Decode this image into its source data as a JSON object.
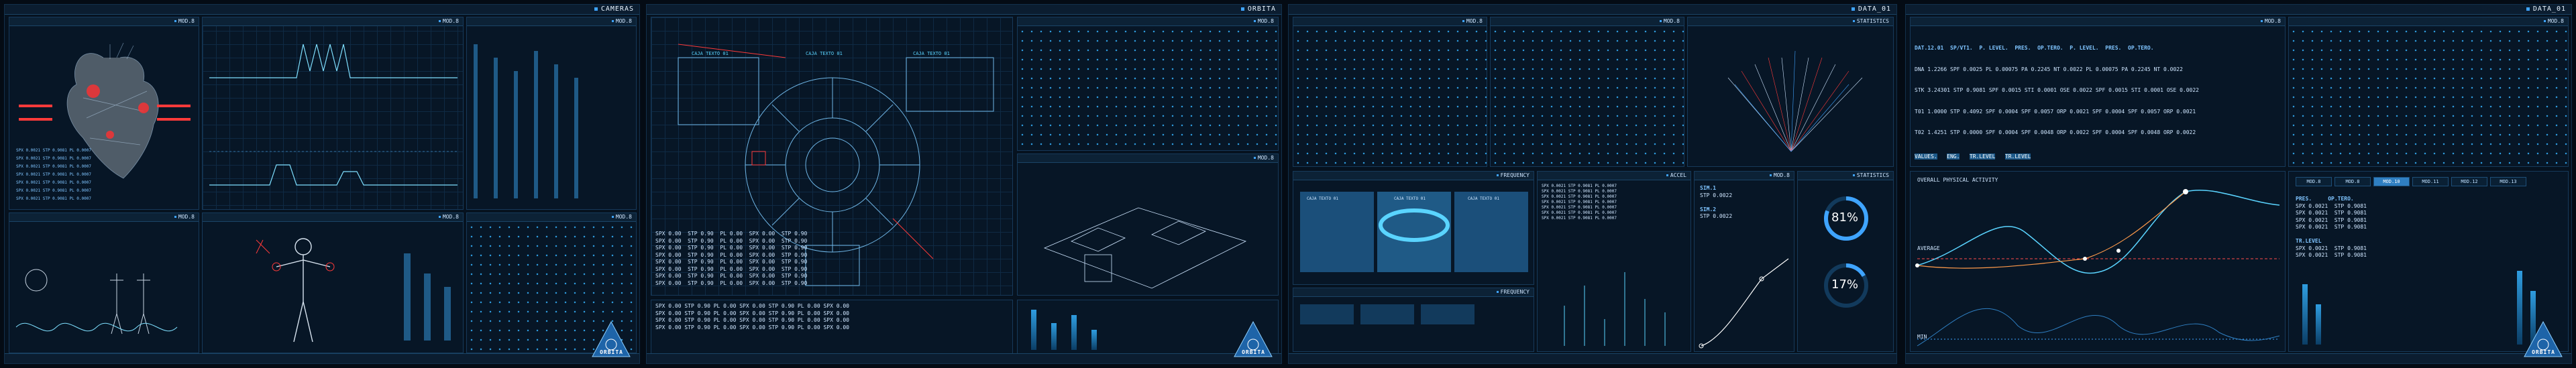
{
  "screens": [
    {
      "title": "CAMERAS"
    },
    {
      "title": "ORBITA"
    },
    {
      "title": "DATA_01"
    },
    {
      "title": "DATA_01"
    }
  ],
  "logo_text": "ORBITA",
  "panels": {
    "s1_top": "MOD.8",
    "s1_chart": "MOD.8",
    "s1_mid": "MOD.8",
    "s1_body": "MOD.8",
    "s1_right": "MOD.8",
    "s2_right_top": "MOD.8",
    "s2_right_mid": "MOD.8",
    "s3_top_a": "MOD.8",
    "s3_top_b": "MOD.8",
    "s3_stats": "STATISTICS",
    "s3_freq": "FREQUENCY",
    "s3_accel": "ACCEL",
    "s3_mod": "MOD.8",
    "s3_stats2": "STATISTICS",
    "s3_freq2": "FREQUENCY",
    "s4_top": "MOD.8",
    "s4_top2": "MOD.8",
    "s4_right": "MOD.8"
  },
  "s2_labels": {
    "caja_a": "CAJA TEXTO 01",
    "caja_b": "CAJA TEXTO 01",
    "caja_c": "CAJA TEXTO 01",
    "caja_d": "CAJA TEXTO 01",
    "caja_e": "CAJA TEXTO 01"
  },
  "s3": {
    "caja": [
      "CAJA TEXTO 01",
      "CAJA TEXTO 01",
      "CAJA TEXTO 01"
    ],
    "sim_titles": [
      "SIM.1",
      "SIM.2",
      "SIM.1",
      "SIM.2"
    ],
    "sim_rows": [
      "STP 0.0022",
      "STP 0.0022",
      "STP 0.0022",
      "STP 0.0022"
    ],
    "gauge1": "81%",
    "gauge2": "17%",
    "gauge1_value": 0.81,
    "gauge2_value": 0.17
  },
  "s4": {
    "table_headers": [
      "DAT.12.01",
      "SP/VT1.",
      "P. LEVEL.",
      "PRES.",
      "OP.TERO.",
      "P. LEVEL.",
      "PRES.",
      "OP.TERO."
    ],
    "table_rows": [
      [
        "DNA 1.2266",
        "SPF 0.0025",
        "PL 0.00075",
        "PA 0.2245",
        "NT 0.0022",
        "PL 0.00075",
        "PA 0.2245",
        "NT 0.0022"
      ],
      [
        "STK 3.24301",
        "STP 0.9081",
        "SPF 0.0015",
        "STI 0.0001",
        "OSE 0.0022",
        "SPF 0.0015",
        "STI 0.0001",
        "OSE 0.0022"
      ],
      [
        "T01 1.0000",
        "STP 0.4092",
        "SPF 0.0004",
        "SPF 0.0057",
        "ORP 0.0021",
        "SPF 0.0004",
        "SPF 0.0057",
        "ORP 0.0021"
      ],
      [
        "T02 1.4251",
        "STP 0.0000",
        "SPF 0.0004",
        "SPF 0.0048",
        "ORP 0.0022",
        "SPF 0.0004",
        "SPF 0.0048",
        "ORP 0.0022"
      ]
    ],
    "tags": [
      "VALUES.",
      "ENG.",
      "TR.LEVEL",
      "TR.LEVEL"
    ],
    "activity_title": "OVERALL PHYSICAL ACTIVITY",
    "axis_labels": [
      "AVERAGE",
      "MIN",
      "MAX"
    ],
    "tabs": [
      "MOD.8",
      "MOD.8",
      "MOD.10",
      "MOD.11",
      "MOD.12",
      "MOD.13"
    ],
    "right_headers": [
      "PRES.",
      "OP.TERO.",
      "TR.LEVEL"
    ]
  }
}
